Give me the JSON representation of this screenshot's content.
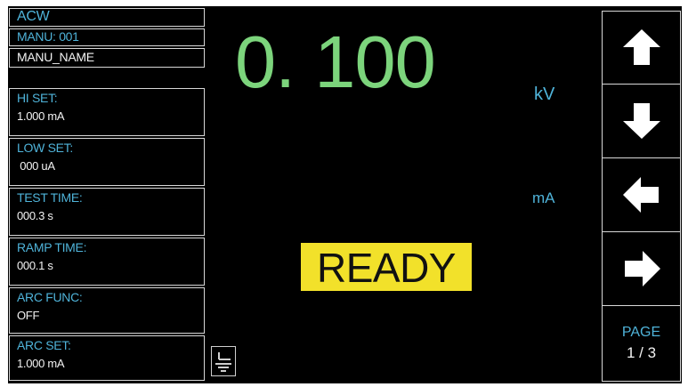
{
  "mode": "ACW",
  "manu_number": "MANU: 001",
  "manu_name": "MANU_NAME",
  "params": [
    {
      "label": "HI SET:",
      "value": "1.000 mA"
    },
    {
      "label": "LOW SET:",
      "value": " 000 uA"
    },
    {
      "label": "TEST TIME:",
      "value": "000.3 s"
    },
    {
      "label": "RAMP TIME:",
      "value": "000.1 s"
    },
    {
      "label": "ARC FUNC:",
      "value": "OFF"
    },
    {
      "label": "ARC SET:",
      "value": "1.000 mA"
    }
  ],
  "readout": {
    "voltage": "0. 100",
    "voltage_unit": "kV",
    "current_unit": "mA",
    "status": "READY"
  },
  "nav": {
    "buttons": [
      "arrow-up-icon",
      "arrow-down-icon",
      "arrow-left-icon",
      "arrow-right-icon"
    ],
    "page_label": "PAGE",
    "page_value": "1 / 3"
  },
  "colors": {
    "background": "#000000",
    "label_blue": "#4fb3d9",
    "voltage_green": "#7cd47c",
    "ready_yellow": "#f2e12a"
  }
}
